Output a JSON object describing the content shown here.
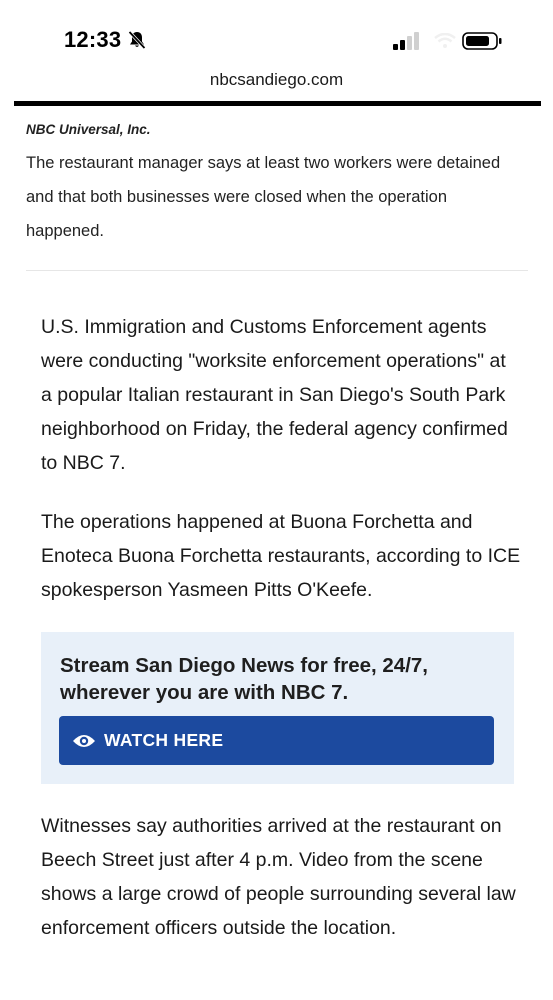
{
  "status_bar": {
    "time": "12:33",
    "icons": [
      "bell-slash-icon",
      "signal-icon",
      "wifi-icon",
      "battery-icon"
    ]
  },
  "browser": {
    "url": "nbcsandiego.com"
  },
  "caption": {
    "credit": "NBC Universal, Inc.",
    "text": "The restaurant manager says at least two workers were detained and that both businesses were closed when the operation happened."
  },
  "article": {
    "paragraphs": [
      "U.S. Immigration and Customs Enforcement agents were conducting \"worksite enforcement operations\" at a popular Italian restaurant in San Diego's South Park neighborhood on Friday, the federal agency confirmed to NBC 7.",
      "The operations happened at Buona Forchetta and Enoteca Buona Forchetta restaurants, according to ICE spokesperson Yasmeen Pitts O'Keefe.",
      "Witnesses say authorities arrived at the restaurant on Beech Street just after 4 p.m. Video from the scene shows a large crowd of people surrounding several law enforcement officers outside the location."
    ]
  },
  "promo": {
    "title": "Stream San Diego News for free, 24/7, wherever you are with NBC 7.",
    "button_label": "WATCH HERE",
    "button_icon": "eye-icon"
  },
  "colors": {
    "button_bg": "#1c4a9f",
    "promo_bg": "#e8f0f9"
  }
}
